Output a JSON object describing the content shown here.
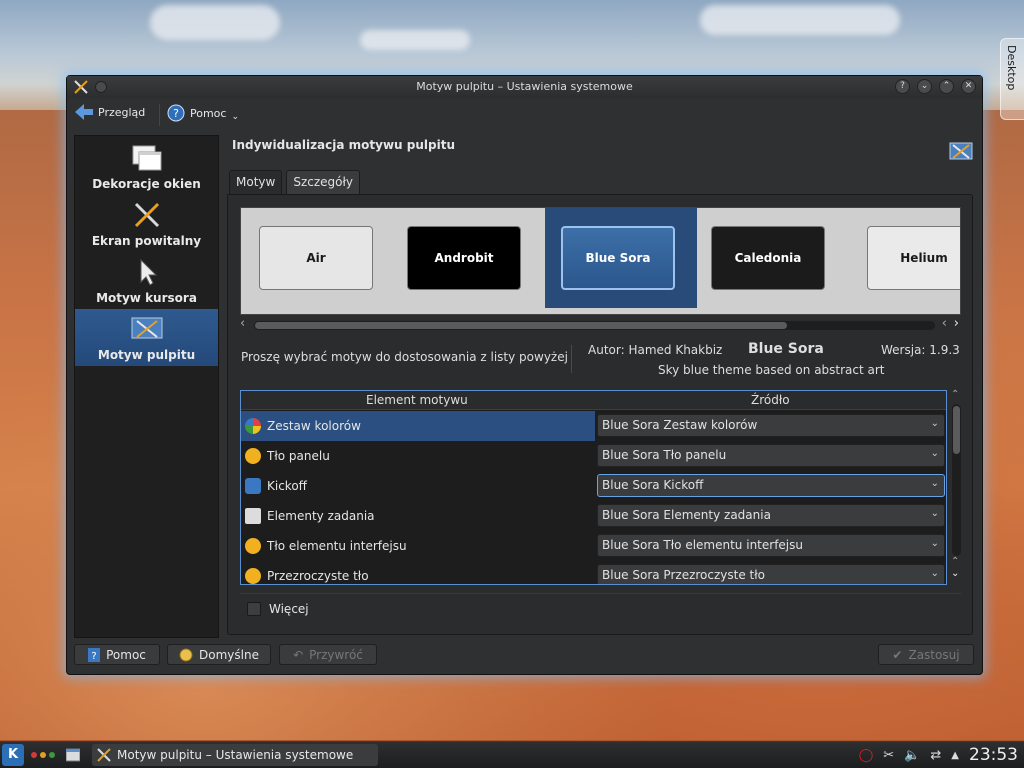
{
  "desktop": {
    "side_tab_label": "Desktop"
  },
  "window": {
    "title": "Motyw pulpitu – Ustawienia systemowe",
    "buttons": {
      "help": "?",
      "minimize": "⌄",
      "maximize": "⌃",
      "close": "✕"
    }
  },
  "toolbar": {
    "overview_label": "Przegląd",
    "help_label": "Pomoc"
  },
  "sidebar": {
    "items": [
      {
        "label": "Dekoracje okien",
        "icon": "window-decorations-icon"
      },
      {
        "label": "Ekran powitalny",
        "icon": "tools-icon"
      },
      {
        "label": "Motyw kursora",
        "icon": "cursor-icon"
      },
      {
        "label": "Motyw pulpitu",
        "icon": "desktop-theme-icon",
        "active": true
      }
    ]
  },
  "main": {
    "heading": "Indywidualizacja motywu pulpitu",
    "tabs": [
      {
        "label": "Motyw"
      },
      {
        "label": "Szczegóły",
        "active": true
      }
    ],
    "themes": [
      {
        "name": "Air",
        "bg": "#e6e6e6",
        "fg": "#1a1a1a"
      },
      {
        "name": "Androbit",
        "bg": "#000000",
        "fg": "#ffffff"
      },
      {
        "name": "Blue Sora",
        "bg": "#2e5d95",
        "fg": "#ffffff",
        "selected": true
      },
      {
        "name": "Caledonia",
        "bg": "#1b1b1b",
        "fg": "#ffffff"
      },
      {
        "name": "Helium",
        "bg": "#eaeaea",
        "fg": "#1a1a1a"
      }
    ],
    "prompt_text": "Proszę wybrać motyw do dostosowania z listy powyżej",
    "author": "Autor: Hamed Khakbiz",
    "theme_name": "Blue Sora",
    "version": "Wersja: 1.9.3",
    "description": "Sky blue theme based on abstract art",
    "table": {
      "col_element": "Element motywu",
      "col_source": "Źródło",
      "rows": [
        {
          "element": "Zestaw kolorów",
          "source": "Blue Sora Zestaw kolorów",
          "icon_color": "#e8a13a",
          "selected": true
        },
        {
          "element": "Tło panelu",
          "source": "Blue Sora Tło panelu",
          "icon_color": "#f0b020"
        },
        {
          "element": "Kickoff",
          "source": "Blue Sora Kickoff",
          "icon_color": "#3b78c4",
          "focused": true
        },
        {
          "element": "Elementy zadania",
          "source": "Blue Sora Elementy zadania",
          "icon_color": "#dcdcdc"
        },
        {
          "element": "Tło elementu interfejsu",
          "source": "Blue Sora Tło elementu interfejsu",
          "icon_color": "#f0b020"
        },
        {
          "element": "Przezroczyste tło",
          "source": "Blue Sora Przezroczyste tło",
          "icon_color": "#f0b020"
        }
      ]
    },
    "more_label": "Więcej"
  },
  "footer": {
    "help": "Pomoc",
    "defaults": "Domyślne",
    "reset": "Przywróć",
    "apply": "Zastosuj"
  },
  "taskbar": {
    "task_label": "Motyw pulpitu – Ustawienia systemowe",
    "clock": "23:53",
    "k_label": "K"
  },
  "colors": {
    "accent": "#2a4f80",
    "focus": "#6aa3e3"
  }
}
